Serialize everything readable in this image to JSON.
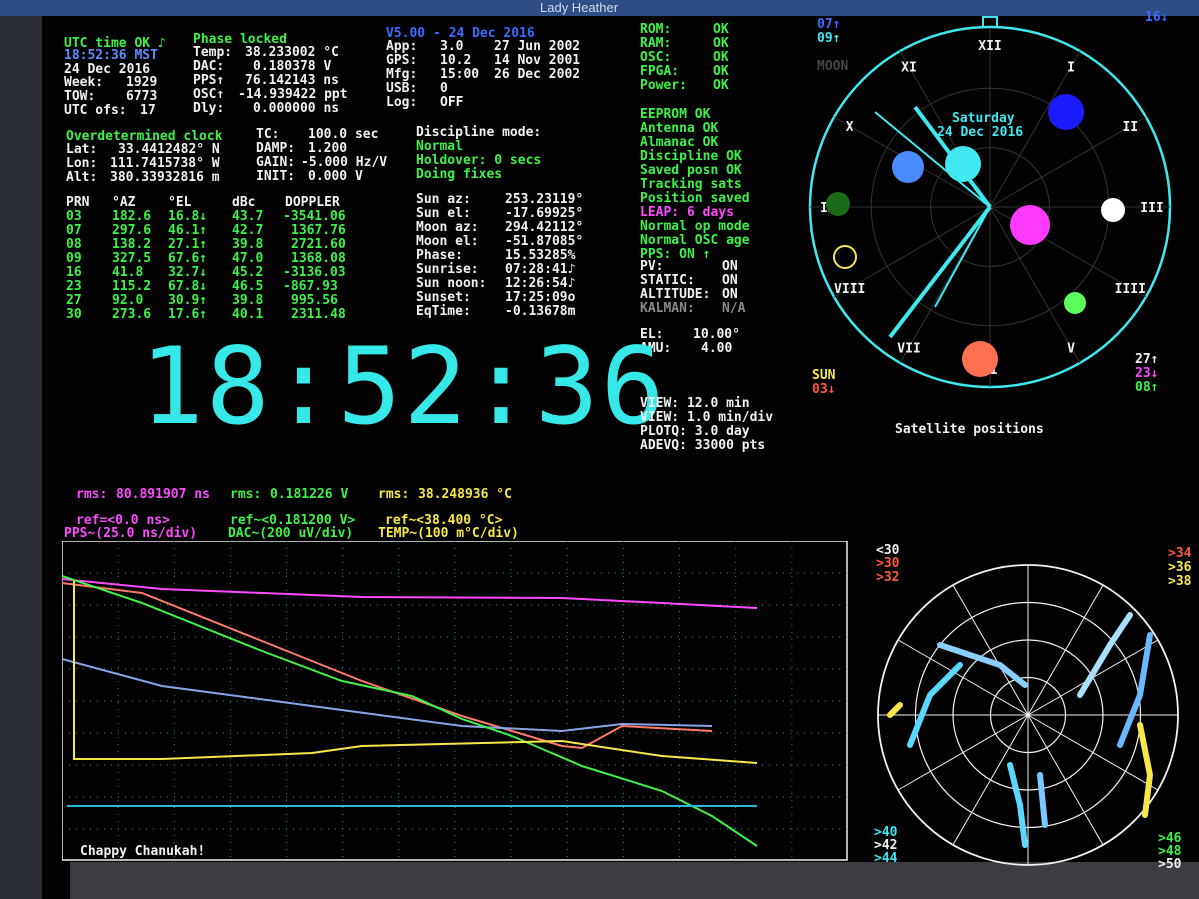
{
  "window": {
    "title": "Lady Heather"
  },
  "status": {
    "utc_line": "UTC time OK ♪",
    "local_time": "18:52:36 MST",
    "date": "24 Dec 2016",
    "week_label": "Week:",
    "week": "1929",
    "tow_label": "TOW:",
    "tow": "6773",
    "utcofs_label": "UTC ofs:",
    "utcofs": "17"
  },
  "phase": {
    "title": "Phase locked",
    "temp_label": "Temp:",
    "temp": "38.233002 °C",
    "dac_label": "DAC:",
    "dac": "0.180378 V",
    "pps_label": "PPS↑",
    "pps": "76.142143 ns",
    "osc_label": "OSC↑",
    "osc": "-14.939422 ppt",
    "dly_label": "Dly:",
    "dly": "0.000000 ns"
  },
  "version": {
    "title": "V5.00 - 24 Dec 2016",
    "rows": [
      {
        "label": "App:",
        "ver": "3.0",
        "date": "27 Jun 2002"
      },
      {
        "label": "GPS:",
        "ver": "10.2",
        "date": "14 Nov 2001"
      },
      {
        "label": "Mfg:",
        "ver": "15:00",
        "date": "26 Dec 2002"
      },
      {
        "label": "USB:",
        "ver": "0",
        "date": ""
      },
      {
        "label": "Log:",
        "ver": "OFF",
        "date": ""
      }
    ]
  },
  "health": {
    "group1": [
      {
        "label": "ROM:",
        "value": "OK"
      },
      {
        "label": "RAM:",
        "value": "OK"
      },
      {
        "label": "OSC:",
        "value": "OK"
      },
      {
        "label": "FPGA:",
        "value": "OK"
      },
      {
        "label": "Power:",
        "value": "OK"
      }
    ],
    "group2": [
      "EEPROM OK",
      "Antenna OK",
      "Almanac OK",
      "Discipline OK",
      "Saved posn OK",
      "Tracking sats",
      "Position saved"
    ],
    "leap": "LEAP: 6 days",
    "normal_op": "Normal op mode",
    "normal_osc": "Normal OSC age",
    "pps": "PPS: ON ↑",
    "flags": [
      {
        "label": "PV:",
        "value": "ON"
      },
      {
        "label": "STATIC:",
        "value": "ON"
      },
      {
        "label": "ALTITUDE:",
        "value": "ON"
      },
      {
        "label": "KALMAN:",
        "value": "N/A"
      }
    ],
    "el_label": "EL:",
    "el": "10.00°",
    "amu_label": "AMU:",
    "amu": "4.00"
  },
  "position": {
    "title": "Overdetermined clock",
    "lat_label": "Lat:",
    "lat": "33.4412482° N",
    "lon_label": "Lon:",
    "lon": "111.7415738° W",
    "alt_label": "Alt:",
    "alt": "380.33932816 m"
  },
  "loop": {
    "tc_label": "TC:",
    "tc": "100.0 sec",
    "damp_label": "DAMP:",
    "damp": "1.200",
    "gain_label": "GAIN:",
    "gain": "-5.000 Hz/V",
    "init_label": "INIT:",
    "init": "0.000 V"
  },
  "discipline": {
    "title": "Discipline mode:",
    "mode": "Normal",
    "holdover": "Holdover: 0 secs",
    "fixes": "Doing fixes"
  },
  "satellites": {
    "headers": [
      "PRN",
      "°AZ",
      "°EL",
      "dBc",
      "DOPPLER"
    ],
    "rows": [
      [
        "03",
        "182.6",
        "16.8↓",
        "43.7",
        "-3541.06"
      ],
      [
        "07",
        "297.6",
        "46.1↑",
        "42.7",
        "1367.76"
      ],
      [
        "08",
        "138.2",
        "27.1↑",
        "39.8",
        "2721.60"
      ],
      [
        "09",
        "327.5",
        "67.6↑",
        "47.0",
        "1368.08"
      ],
      [
        "16",
        "41.8",
        "32.7↓",
        "45.2",
        "-3136.03"
      ],
      [
        "23",
        "115.2",
        "67.8↓",
        "46.5",
        "-867.93"
      ],
      [
        "27",
        "92.0",
        "30.9↑",
        "39.8",
        "995.56"
      ],
      [
        "30",
        "273.6",
        "17.6↑",
        "40.1",
        "2311.48"
      ]
    ]
  },
  "sun_moon": [
    {
      "label": "Sun az:",
      "value": "253.23119°"
    },
    {
      "label": "Sun el:",
      "value": "-17.69925°"
    },
    {
      "label": "Moon az:",
      "value": "294.42112°"
    },
    {
      "label": "Moon el:",
      "value": "-51.87085°"
    },
    {
      "label": "Phase:",
      "value": "15.53285%"
    },
    {
      "label": "Sunrise:",
      "value": "07:28:41♪"
    },
    {
      "label": "Sun noon:",
      "value": "12:26:54♪"
    },
    {
      "label": "Sunset:",
      "value": "17:25:09o"
    },
    {
      "label": "EqTime:",
      "value": "-0.13678m"
    }
  ],
  "clock": {
    "time": "18:52:36"
  },
  "view": [
    "VIEW: 12.0 min",
    "VIEW: 1.0 min/div",
    "PLOTQ: 3.0 day",
    "ADEVQ: 33000 pts"
  ],
  "skyplot": {
    "title": "Satellite positions",
    "weekday": "Saturday",
    "date": "24 Dec 2016",
    "moon_label": "MOON",
    "top_left": [
      "07↑",
      "09↑"
    ],
    "top_right": "16↓",
    "sun_label": "SUN",
    "sun_sat": "03↓",
    "bottom_right": [
      "27↑",
      "23↓",
      "08↑"
    ],
    "hours": [
      "XII",
      "I",
      "II",
      "III",
      "IIII",
      "V",
      "VI",
      "VII",
      "VIII",
      "IX",
      "X",
      "XI"
    ]
  },
  "graph": {
    "rms": [
      {
        "label": "rms:",
        "value": "80.891907 ns"
      },
      {
        "label": "rms:",
        "value": "0.181226 V"
      },
      {
        "label": "rms:",
        "value": "38.248936 °C"
      }
    ],
    "refs": [
      "ref=<0.0 ns>",
      "ref~<0.181200 V>",
      "ref~<38.400 °C>"
    ],
    "scales": [
      "PPS~(25.0 ns/div)",
      "DAC~(200 uV/div)",
      "TEMP~(100 m°C/div)"
    ],
    "footer": "Chappy Chanukah!"
  },
  "signal_plot": {
    "left_labels": [
      "<30",
      ">30",
      ">32"
    ],
    "right_labels": [
      ">34",
      ">36",
      ">38"
    ],
    "bottom_left": [
      ">40",
      ">42",
      ">44"
    ],
    "bottom_right": [
      ">46",
      ">48",
      ">50"
    ]
  },
  "colors": {
    "green": "#3ff24a",
    "white": "#f2f2f2",
    "blue": "#3f6bff",
    "yellow": "#f7e84a",
    "magenta": "#ff4aff",
    "cyan": "#40e8f0",
    "red": "#ff5a3a"
  }
}
